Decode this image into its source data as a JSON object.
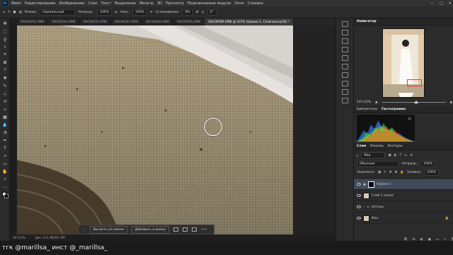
{
  "menu": {
    "logo": "Ps",
    "items": [
      "Файл",
      "Редактирование",
      "Изображение",
      "Слои",
      "Текст",
      "Выделение",
      "Фильтр",
      "3D",
      "Просмотр",
      "Подключаемые модули",
      "Окно",
      "Справка"
    ],
    "window_controls": [
      "—",
      "□",
      "✕"
    ]
  },
  "options": {
    "mode_label": "Режим:",
    "mode_value": "Нормальный",
    "opacity_label": "Непрозр.:",
    "opacity_value": "100%",
    "flow_label": "Наж.:",
    "flow_value": "100%",
    "smoothing_label": "Сглаживание:",
    "smoothing_value": "0%",
    "angle_value": "0°"
  },
  "tabs": [
    {
      "label": "DSC06251.ARW",
      "active": false
    },
    {
      "label": "DSC06254.ARW",
      "active": false
    },
    {
      "label": "DSC06255.ARW",
      "active": false
    },
    {
      "label": "DSC06267.ARW",
      "active": false
    },
    {
      "label": "DSC06283.ARW",
      "active": false
    },
    {
      "label": "DSC06305.ARW",
      "active": false
    },
    {
      "label": "DSC06589.ARW @ 107% (Уровни 1, Слой-маска/16) *",
      "active": true
    }
  ],
  "status": {
    "zoom": "107,03%",
    "doc": "Док: 122,3М/367,5М"
  },
  "context_bar": {
    "subtract": "Вычесть из маски",
    "add": "Добавить в маску",
    "more": "•••"
  },
  "navigator": {
    "title": "Навигатор",
    "zoom": "107,03%"
  },
  "histogram": {
    "tabs": [
      "Библиотеки",
      "Гистограмма"
    ]
  },
  "layers_panel": {
    "tabs": [
      "Слои",
      "Каналы",
      "Контуры"
    ],
    "search_placeholder": "Вид",
    "blend": "Обычные",
    "opacity_label": "Непрозр.:",
    "opacity_value": "100%",
    "lock_label": "Закрепить:",
    "fill_label": "Заливка:",
    "fill_value": "100%",
    "layers": [
      {
        "name": "Уровни 1",
        "selected": true
      },
      {
        "name": "Слой 1 копия",
        "selected": false
      },
      {
        "name": "ретушь",
        "selected": false
      },
      {
        "name": "Фон",
        "selected": false
      }
    ],
    "bottom_icons": [
      "fx",
      "◐",
      "▣",
      "▭",
      "+",
      "🗑"
    ]
  },
  "watermark": "тгк @marillsa_   инст @_marillsa_",
  "colors": {
    "accent": "#31a8ff",
    "selected_layer": "#3f4a5a",
    "canvas": "#a39476"
  }
}
